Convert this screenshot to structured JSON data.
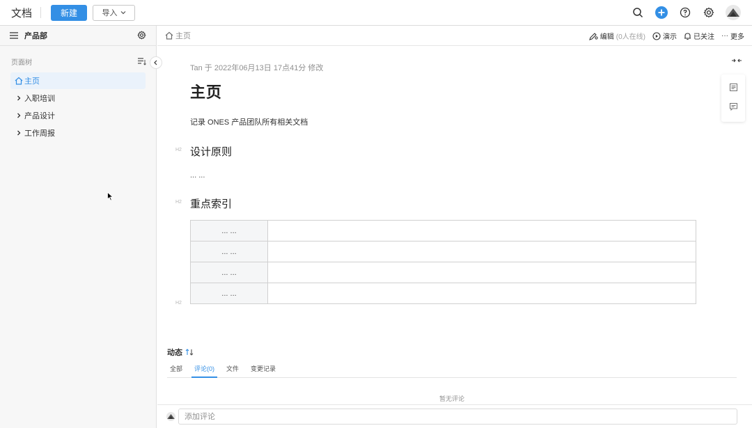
{
  "header": {
    "app_title": "文档",
    "new_label": "新建",
    "import_label": "导入"
  },
  "sidebar": {
    "team_name": "产品部",
    "tree_label": "页面树",
    "items": [
      {
        "label": "主页",
        "active": true
      },
      {
        "label": "入职培训"
      },
      {
        "label": "产品设计"
      },
      {
        "label": "工作周报"
      }
    ]
  },
  "breadcrumb": {
    "current": "主页"
  },
  "actions": {
    "edit": "编辑",
    "online": "(0人在线)",
    "present": "演示",
    "follow": "已关注",
    "more": "更多"
  },
  "doc": {
    "meta": "Tan 于 2022年06月13日 17点41分 修改",
    "title": "主页",
    "description": "记录 ONES 产品团队所有相关文档",
    "heading_marker": "H2",
    "section1": {
      "heading": "设计原则",
      "body": "... ..."
    },
    "section2": {
      "heading": "重点索引"
    },
    "table_rows": [
      [
        "... ...",
        ""
      ],
      [
        "... ...",
        ""
      ],
      [
        "... ...",
        ""
      ],
      [
        "... ...",
        ""
      ]
    ]
  },
  "activity": {
    "title": "动态",
    "tabs": [
      "全部",
      "评论(0)",
      "文件",
      "变更记录"
    ],
    "active_tab": 1,
    "empty_text": "暂无评论"
  },
  "comment": {
    "placeholder": "添加评论"
  },
  "colors": {
    "accent": "#338fe5",
    "sidebar_bg": "#f7f7f7"
  }
}
